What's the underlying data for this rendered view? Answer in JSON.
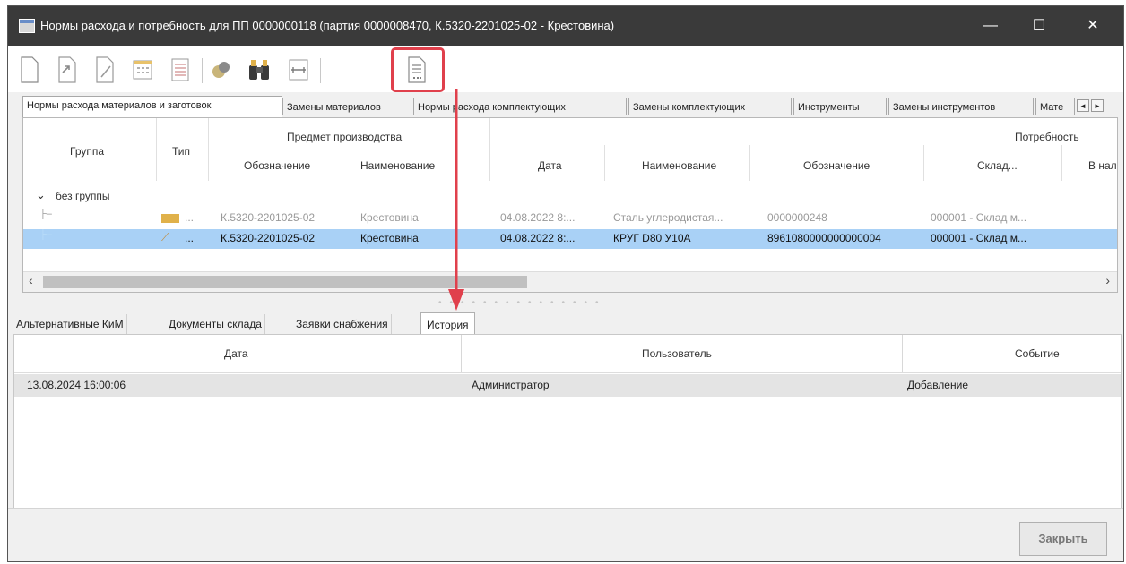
{
  "window": {
    "title": "Нормы расхода и потребность для ПП 0000000118 (партия 0000008470, К.5320-2201025-02 - Крестовина)",
    "minimize_glyph": "—",
    "maximize_glyph": "☐",
    "close_glyph": "✕"
  },
  "toolbar": {
    "buttons": [
      "new-document-icon",
      "open-document-icon",
      "edit-icon",
      "calendar-icon",
      "list-edit-icon",
      "materials-icon",
      "binoculars-icon",
      "measure-icon",
      "document-details-icon"
    ]
  },
  "top_tabs": [
    "Нормы расхода материалов и заготовок",
    "Замены материалов",
    "Нормы расхода комплектующих",
    "Замены комплектующих",
    "Инструменты",
    "Замены инструментов",
    "Мате"
  ],
  "top_tab_scroll": {
    "left": "◄",
    "right": "►"
  },
  "top_grid": {
    "headers": {
      "group": "Группа",
      "type": "Тип",
      "subject": "Предмет производства",
      "designation": "Обозначение",
      "name": "Наименование",
      "date": "Дата",
      "need": "Потребность",
      "need_name": "Наименование",
      "need_designation": "Обозначение",
      "warehouse": "Склад...",
      "in_stock": "В нал"
    },
    "group_label": "без группы",
    "group_chevron": "⌄",
    "rows": [
      {
        "type": "...",
        "designation": "К.5320-2201025-02",
        "name": "Крестовина",
        "date": "04.08.2022 8:...",
        "need_name": "Сталь углеродистая...",
        "need_designation": "0000000248",
        "warehouse": "000001 - Склад м..."
      },
      {
        "type": "...",
        "designation": "К.5320-2201025-02",
        "name": "Крестовина",
        "date": "04.08.2022 8:...",
        "need_name": "КРУГ D80  У10А",
        "need_designation": "8961080000000000004",
        "warehouse": "000001 - Склад м..."
      }
    ],
    "scroll_left": "‹",
    "scroll_right": "›"
  },
  "bottom_tabs": [
    "Альтернативные КиМ",
    "Документы склада",
    "Заявки снабжения",
    "История"
  ],
  "history": {
    "headers": {
      "date": "Дата",
      "user": "Пользователь",
      "event": "Событие"
    },
    "rows": [
      {
        "date": "13.08.2024 16:00:06",
        "user": "Администратор",
        "event": "Добавление"
      }
    ]
  },
  "footer": {
    "close_label": "Закрыть"
  },
  "colors": {
    "title_bar": "#3a3a3a",
    "selected_row": "#a9d1f6",
    "highlight": "#e0404c"
  }
}
